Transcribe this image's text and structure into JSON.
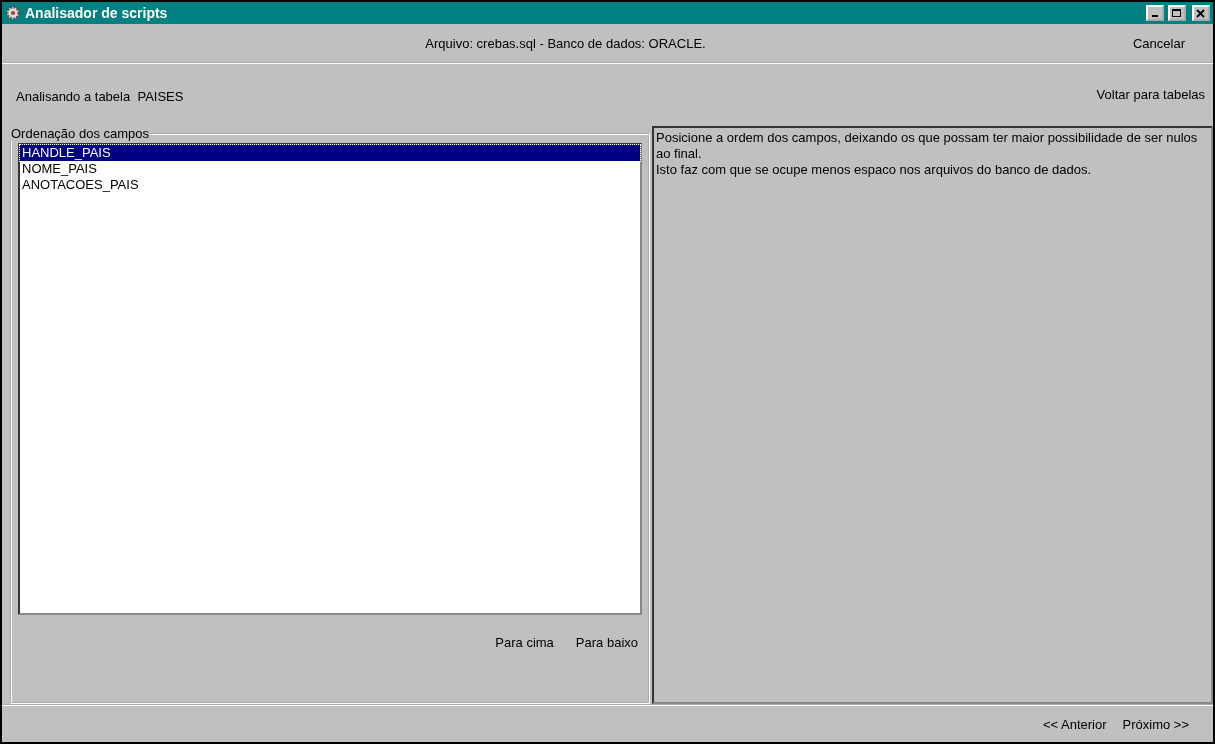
{
  "window": {
    "title": "Analisador de scripts"
  },
  "header": {
    "info": "Arquivo: crebas.sql - Banco de dados: ORACLE.",
    "cancel": "Cancelar"
  },
  "subheader": {
    "status": "Analisando a tabela  PAISES",
    "back": "Voltar para tabelas"
  },
  "field_order": {
    "title": "Ordenação dos campos",
    "items": [
      {
        "label": "HANDLE_PAIS",
        "selected": true
      },
      {
        "label": "NOME_PAIS",
        "selected": false
      },
      {
        "label": "ANOTACOES_PAIS",
        "selected": false
      }
    ],
    "buttons": [
      "Para cima",
      "Para baixo"
    ]
  },
  "hint": "Posicione a ordem dos campos, deixando os que possam ter maior possibilidade de ser nulos ao final.\nIsto faz com que se ocupe menos espaco nos arquivos do banco de dados.",
  "nav": {
    "previous": "<< Anterior",
    "next": "Próximo >>"
  }
}
